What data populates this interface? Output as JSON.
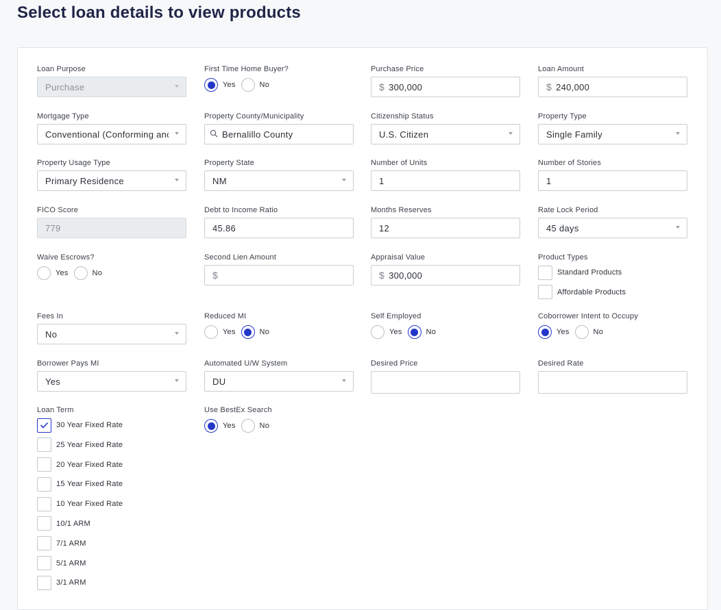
{
  "page": {
    "title": "Select loan details to view products"
  },
  "colors": {
    "accent": "#2436c8",
    "title": "#1f2547"
  },
  "form": {
    "loan_purpose": {
      "label": "Loan Purpose",
      "value": "Purchase"
    },
    "first_time_buyer": {
      "label": "First Time Home Buyer?",
      "yes": "Yes",
      "no": "No",
      "selected": "Yes"
    },
    "purchase_price": {
      "label": "Purchase Price",
      "prefix": "$",
      "value": "300,000"
    },
    "loan_amount": {
      "label": "Loan Amount",
      "prefix": "$",
      "value": "240,000"
    },
    "mortgage_type": {
      "label": "Mortgage Type",
      "value": "Conventional (Conforming and Jumbo)"
    },
    "property_county": {
      "label": "Property County/Municipality",
      "value": "Bernalillo County"
    },
    "citizenship": {
      "label": "Citizenship Status",
      "value": "U.S. Citizen"
    },
    "property_type": {
      "label": "Property Type",
      "value": "Single Family"
    },
    "usage_type": {
      "label": "Property Usage Type",
      "value": "Primary Residence"
    },
    "property_state": {
      "label": "Property State",
      "value": "NM"
    },
    "units": {
      "label": "Number of Units",
      "value": "1"
    },
    "stories": {
      "label": "Number of Stories",
      "value": "1"
    },
    "fico": {
      "label": "FICO Score",
      "value": "779"
    },
    "dti": {
      "label": "Debt to Income Ratio",
      "value": "45.86"
    },
    "reserves": {
      "label": "Months Reserves",
      "value": "12"
    },
    "rate_lock": {
      "label": "Rate Lock Period",
      "value": "45 days"
    },
    "waive_escrows": {
      "label": "Waive Escrows?",
      "yes": "Yes",
      "no": "No",
      "selected": ""
    },
    "second_lien": {
      "label": "Second Lien Amount",
      "prefix": "$",
      "value": ""
    },
    "appraisal": {
      "label": "Appraisal Value",
      "prefix": "$",
      "value": "300,000"
    },
    "product_types": {
      "label": "Product Types",
      "options": [
        "Standard Products",
        "Affordable Products"
      ],
      "checked": [
        false,
        false
      ]
    },
    "fees_in": {
      "label": "Fees In",
      "value": "No"
    },
    "reduced_mi": {
      "label": "Reduced MI",
      "yes": "Yes",
      "no": "No",
      "selected": "No"
    },
    "self_employed": {
      "label": "Self Employed",
      "yes": "Yes",
      "no": "No",
      "selected": "No"
    },
    "coborrower": {
      "label": "Coborrower Intent to Occupy",
      "yes": "Yes",
      "no": "No",
      "selected": "Yes"
    },
    "borrower_pays_mi": {
      "label": "Borrower Pays MI",
      "value": "Yes"
    },
    "aus": {
      "label": "Automated U/W System",
      "value": "DU"
    },
    "desired_price": {
      "label": "Desired Price",
      "value": ""
    },
    "desired_rate": {
      "label": "Desired Rate",
      "value": ""
    },
    "loan_term": {
      "label": "Loan Term",
      "options": [
        "30 Year Fixed Rate",
        "25 Year Fixed Rate",
        "20 Year Fixed Rate",
        "15 Year Fixed Rate",
        "10 Year Fixed Rate",
        "10/1 ARM",
        "7/1 ARM",
        "5/1 ARM",
        "3/1 ARM"
      ],
      "checked": [
        true,
        false,
        false,
        false,
        false,
        false,
        false,
        false,
        false
      ]
    },
    "bestex": {
      "label": "Use BestEx Search",
      "yes": "Yes",
      "no": "No",
      "selected": "Yes"
    }
  }
}
